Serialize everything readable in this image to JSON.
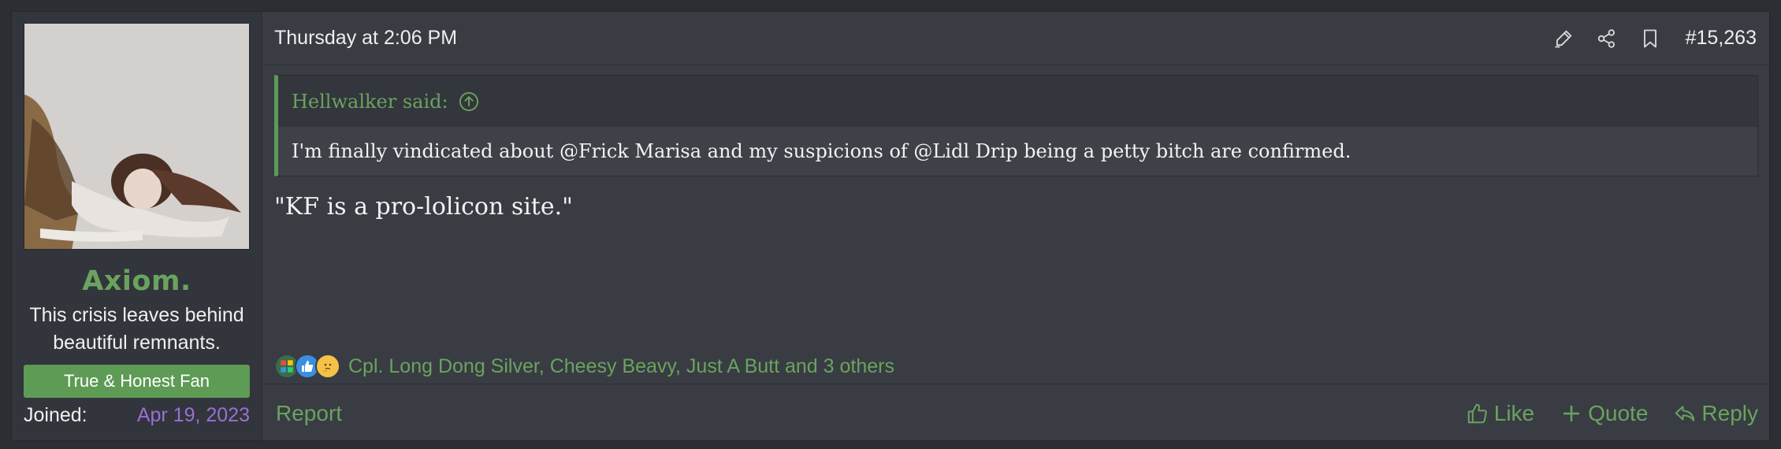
{
  "user": {
    "username": "Axiom.",
    "title": "This crisis leaves behind beautiful remnants.",
    "banner": "True & Honest Fan",
    "joined_label": "Joined:",
    "joined_value": "Apr 19, 2023"
  },
  "post": {
    "date": "Thursday at 2:06 PM",
    "number": "#15,263",
    "quote_author": "Hellwalker said:",
    "quote_text": "I'm finally vindicated about @Frick Marisa and my suspicions of @Lidl Drip being a petty bitch are confirmed.",
    "message": "\"KF is a pro-lolicon site.\""
  },
  "header_icons": [
    "highlight-icon",
    "share-icon",
    "bookmark-icon"
  ],
  "reactions": {
    "icons": [
      "puzzle-reaction-icon",
      "thumbs-up-reaction-icon",
      "thinking-face-reaction-icon"
    ],
    "text": "Cpl. Long Dong Silver, Cheesy Beavy, Just A Butt and 3 others"
  },
  "footer": {
    "report": "Report",
    "like": "Like",
    "quote": "Quote",
    "reply": "Reply"
  },
  "colors": {
    "accent_green": "#6aa35f",
    "banner_green": "#5e9b55",
    "joined_purple": "#9a6fd6",
    "background": "#2b2e33",
    "post_bg": "#393c43"
  }
}
